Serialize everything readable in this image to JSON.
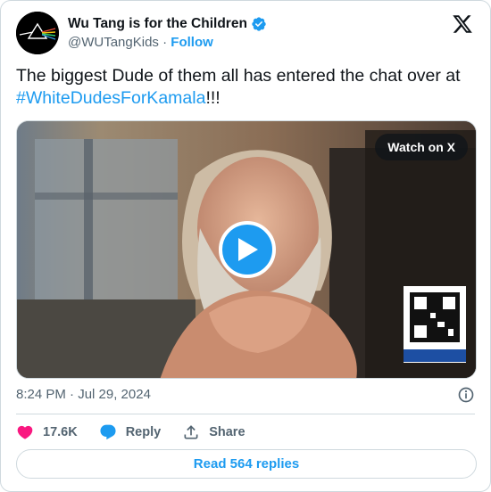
{
  "tweet": {
    "author_name": "Wu Tang is for the Children",
    "handle": "@WUTangKids",
    "separator": "·",
    "follow_label": "Follow",
    "text_main": "The biggest Dude of them all has entered the chat over at ",
    "hashtag": "#WhiteDudesForKamala",
    "text_suffix": "!!!",
    "watch_label": "Watch on X",
    "timestamp": "8:24 PM · Jul 29, 2024",
    "likes": "17.6K",
    "reply_label": "Reply",
    "share_label": "Share",
    "read_replies_label": "Read 564 replies"
  },
  "colors": {
    "accent": "#1d9bf0",
    "like": "#f91880",
    "text_secondary": "#536471",
    "border": "#cfd9de"
  },
  "icons": [
    "verified-badge-icon",
    "x-logo-icon",
    "play-icon",
    "info-icon",
    "heart-icon",
    "reply-bubble-icon",
    "share-icon"
  ]
}
